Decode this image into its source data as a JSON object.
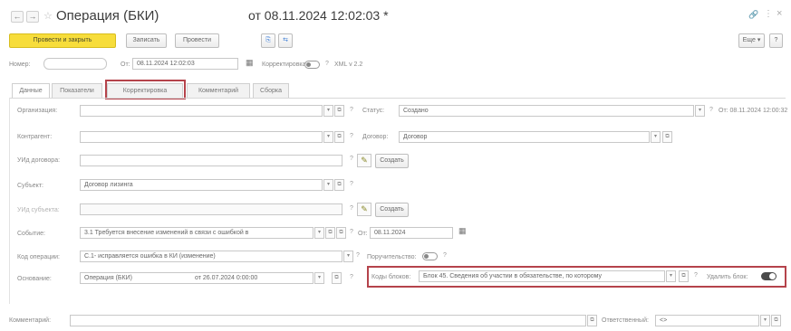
{
  "header": {
    "back": "←",
    "forward": "→",
    "star": "☆",
    "title": "Операция (БКИ)",
    "subtitle": "от 08.11.2024 12:02:03 *",
    "link": "🔗",
    "more": "⋮",
    "close": "×"
  },
  "toolbar": {
    "post_close": "Провести и закрыть",
    "save": "Записать",
    "post": "Провести",
    "btn_icon1": "⎘",
    "btn_icon2": "⇆",
    "more": "Еще ▾",
    "help": "?"
  },
  "topfields": {
    "number_label": "Номер:",
    "number_value": "",
    "from_label": "От:",
    "from_value": "08.11.2024 12:02:03",
    "cal_icon": "▦",
    "correction_label": "Корректировка:",
    "q": "?",
    "xml_label": "XML v 2.2"
  },
  "tabs": [
    "Данные",
    "Показатели",
    "Корректировка",
    "Комментарий",
    "Сборка"
  ],
  "form": {
    "org_label": "Организация:",
    "contractor_label": "Контрагент:",
    "uid_label": "УИд договора:",
    "subject_label": "Субъект:",
    "subject_value": "Договор лизинга",
    "uid_subject_label": "УИд субъекта:",
    "event_label": "Событие:",
    "event_value": "3.1 Требуется внесение изменений в связи с ошибкой в",
    "event_from_label": "От:",
    "event_from_value": "08.11.2024",
    "opcode_label": "Код операции:",
    "opcode_value": "С.1- исправляется ошибка в КИ (изменение)",
    "basis_label": "Основание:",
    "basis_value": "Операция (БКИ)",
    "basis_date": "от 26.07.2024 0:00:00",
    "status_label": "Статус:",
    "status_value": "Создано",
    "status_from": "От: 08.11.2024 12:00:32",
    "contract_label": "Договор:",
    "contract_value": "Договор",
    "create1": "Создать",
    "create2": "Создать",
    "guarantee_label": "Поручительство:",
    "block_code_label": "Коды блоков:",
    "block_code_value": "Блок 45. Сведения об участии в обязательстве, по которому",
    "delete_block_label": "Удалить блок:",
    "dropdown": "▾",
    "open": "⧉",
    "q": "?",
    "pencil": "✎"
  },
  "footer": {
    "comment_label": "Комментарий:",
    "comment_value": "",
    "responsible_label": "Ответственный:",
    "responsible_value": "<>",
    "dropdown": "▾",
    "open": "⧉"
  }
}
